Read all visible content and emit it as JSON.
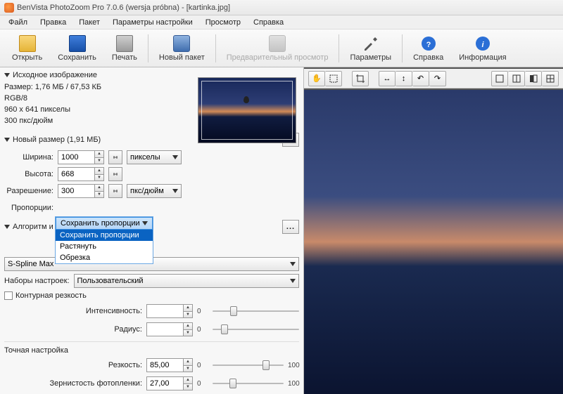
{
  "window": {
    "title": "BenVista PhotoZoom Pro 7.0.6 (wersja próbna) - [kartinka.jpg]"
  },
  "menu": {
    "file": "Файл",
    "edit": "Правка",
    "batch": "Пакет",
    "params": "Параметры настройки",
    "view": "Просмотр",
    "help": "Справка"
  },
  "toolbar": {
    "open": "Открыть",
    "save": "Сохранить",
    "print": "Печать",
    "newbatch": "Новый пакет",
    "preview": "Предварительный просмотр",
    "params": "Параметры",
    "help": "Справка",
    "info": "Информация"
  },
  "src": {
    "header": "Исходное изображение",
    "size": "Размер: 1,76 МБ / 67,53 КБ",
    "mode": "RGB/8",
    "dims": "960 x 641 пикселы",
    "dpi": "300 пкс/дюйм"
  },
  "newsize": {
    "header": "Новый размер (1,91 МБ)",
    "width_lbl": "Ширина:",
    "width_val": "1000",
    "height_lbl": "Высота:",
    "height_val": "668",
    "res_lbl": "Разрешение:",
    "res_val": "300",
    "unit_px": "пикселы",
    "unit_dpi": "пкс/дюйм",
    "aspect_lbl": "Пропорции:",
    "aspect_selected": "Сохранить пропорции",
    "aspect_options": {
      "keep": "Сохранить пропорции",
      "stretch": "Растянуть",
      "crop": "Обрезка"
    }
  },
  "algo": {
    "header": "Алгоритм и",
    "method": "S-Spline Max",
    "presets_lbl": "Наборы настроек:",
    "preset": "Пользовательский",
    "contour_chk": "Контурная резкость",
    "intensity_lbl": "Интенсивность:",
    "radius_lbl": "Радиус:"
  },
  "fine": {
    "header": "Точная настройка",
    "sharp_lbl": "Резкость:",
    "sharp_val": "85,00",
    "grain_lbl": "Зернистость фотопленки:",
    "grain_val": "27,00",
    "min": "0",
    "max": "100"
  },
  "ellipsis": "..."
}
